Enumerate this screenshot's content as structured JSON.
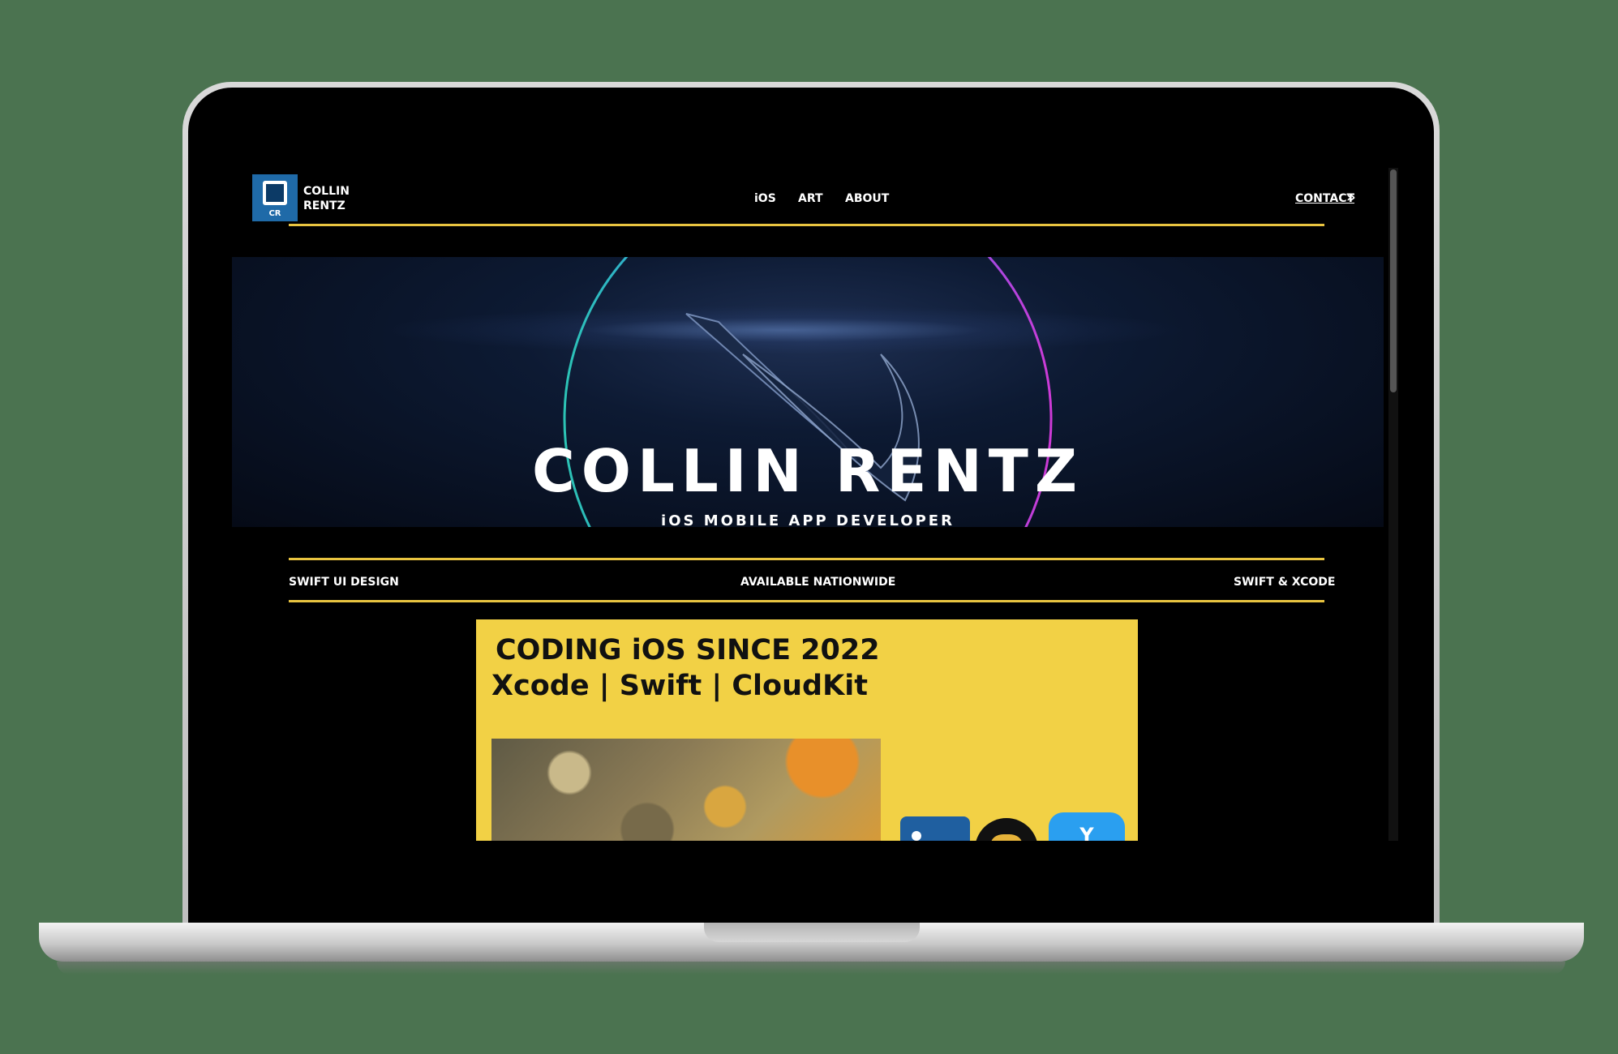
{
  "logo": {
    "badge": "CR",
    "name_line1": "COLLIN",
    "name_line2": "RENTZ"
  },
  "nav": {
    "ios": "iOS",
    "art": "ART",
    "about": "ABOUT"
  },
  "contact": {
    "label": "CONTACT",
    "icon": "»"
  },
  "hero": {
    "title": "COLLIN RENTZ",
    "subtitle": "iOS MOBILE APP DEVELOPER"
  },
  "strip": {
    "left": "SWIFT UI DESIGN",
    "middle": "AVAILABLE NATIONWIDE",
    "right": "SWIFT & XCODE"
  },
  "card": {
    "heading": "CODING iOS SINCE 2022",
    "subheading": "Xcode  |  Swift  |  CloudKit",
    "app_glyph": "Y"
  },
  "colors": {
    "accent_gold": "#e9c440",
    "card_yellow": "#f2d145",
    "logo_blue": "#1f6aa8",
    "background": "#000000"
  }
}
